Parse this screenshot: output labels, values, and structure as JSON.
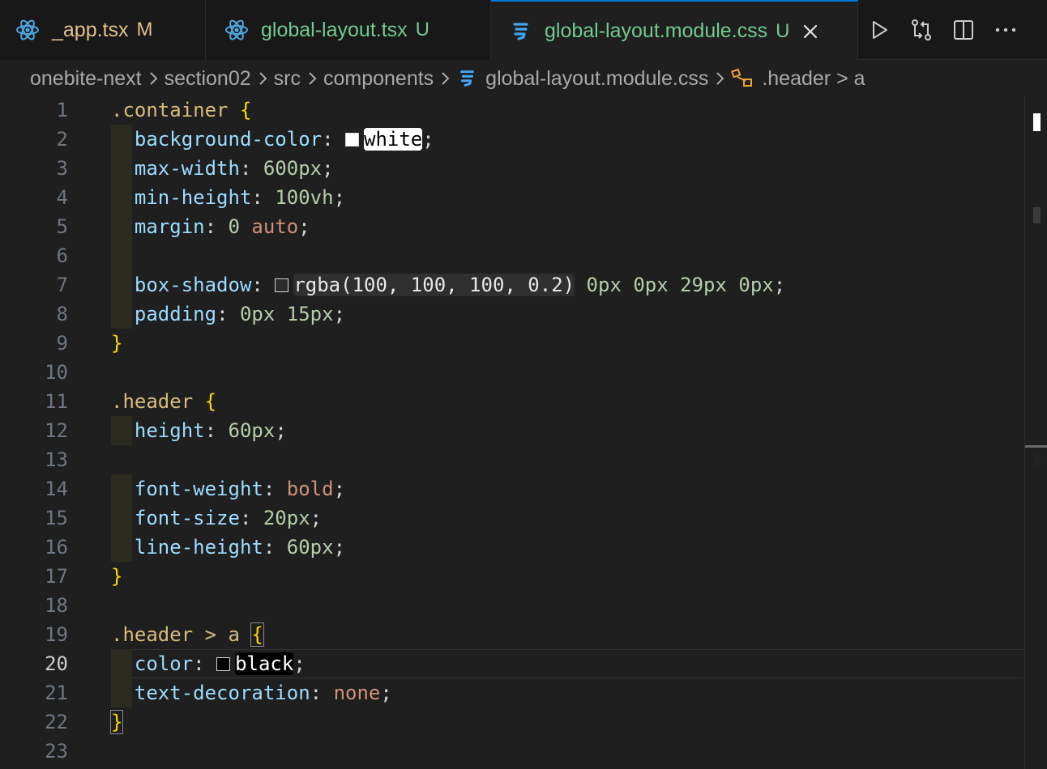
{
  "tabs": [
    {
      "name": "_app.tsx",
      "status": "M",
      "icon": "react-icon"
    },
    {
      "name": "global-layout.tsx",
      "status": "U",
      "icon": "react-icon"
    },
    {
      "name": "global-layout.module.css",
      "status": "U",
      "icon": "css-icon",
      "active": true
    }
  ],
  "breadcrumb": [
    "onebite-next",
    "section02",
    "src",
    "components",
    "global-layout.module.css",
    ".header > a"
  ],
  "editor": {
    "active_line": 20,
    "line_numbers": [
      "1",
      "2",
      "3",
      "4",
      "5",
      "6",
      "7",
      "8",
      "9",
      "10",
      "11",
      "12",
      "13",
      "14",
      "15",
      "16",
      "17",
      "18",
      "19",
      "20",
      "21",
      "22",
      "23"
    ],
    "code": {
      "l1_sel": ".container",
      "l2_prop": "background-color",
      "l2_val": "white",
      "l3_prop": "max-width",
      "l3_val": "600px",
      "l4_prop": "min-height",
      "l4_val": "100vh",
      "l5_prop": "margin",
      "l5_val_a": "0",
      "l5_val_b": "auto",
      "l7_prop": "box-shadow",
      "l7_color": "rgba(100, 100, 100, 0.2)",
      "l7_rest": "0px 0px 29px 0px",
      "l8_prop": "padding",
      "l8_val": "0px 15px",
      "l11_sel": ".header",
      "l12_prop": "height",
      "l12_val": "60px",
      "l14_prop": "font-weight",
      "l14_val": "bold",
      "l15_prop": "font-size",
      "l15_val": "20px",
      "l16_prop": "line-height",
      "l16_val": "60px",
      "l19_sel": ".header > a",
      "l20_prop": "color",
      "l20_val": "black",
      "l21_prop": "text-decoration",
      "l21_val": "none"
    }
  },
  "colors": {
    "accent": "#0078d4",
    "modified": "#e2c08d",
    "untracked": "#73c991"
  }
}
